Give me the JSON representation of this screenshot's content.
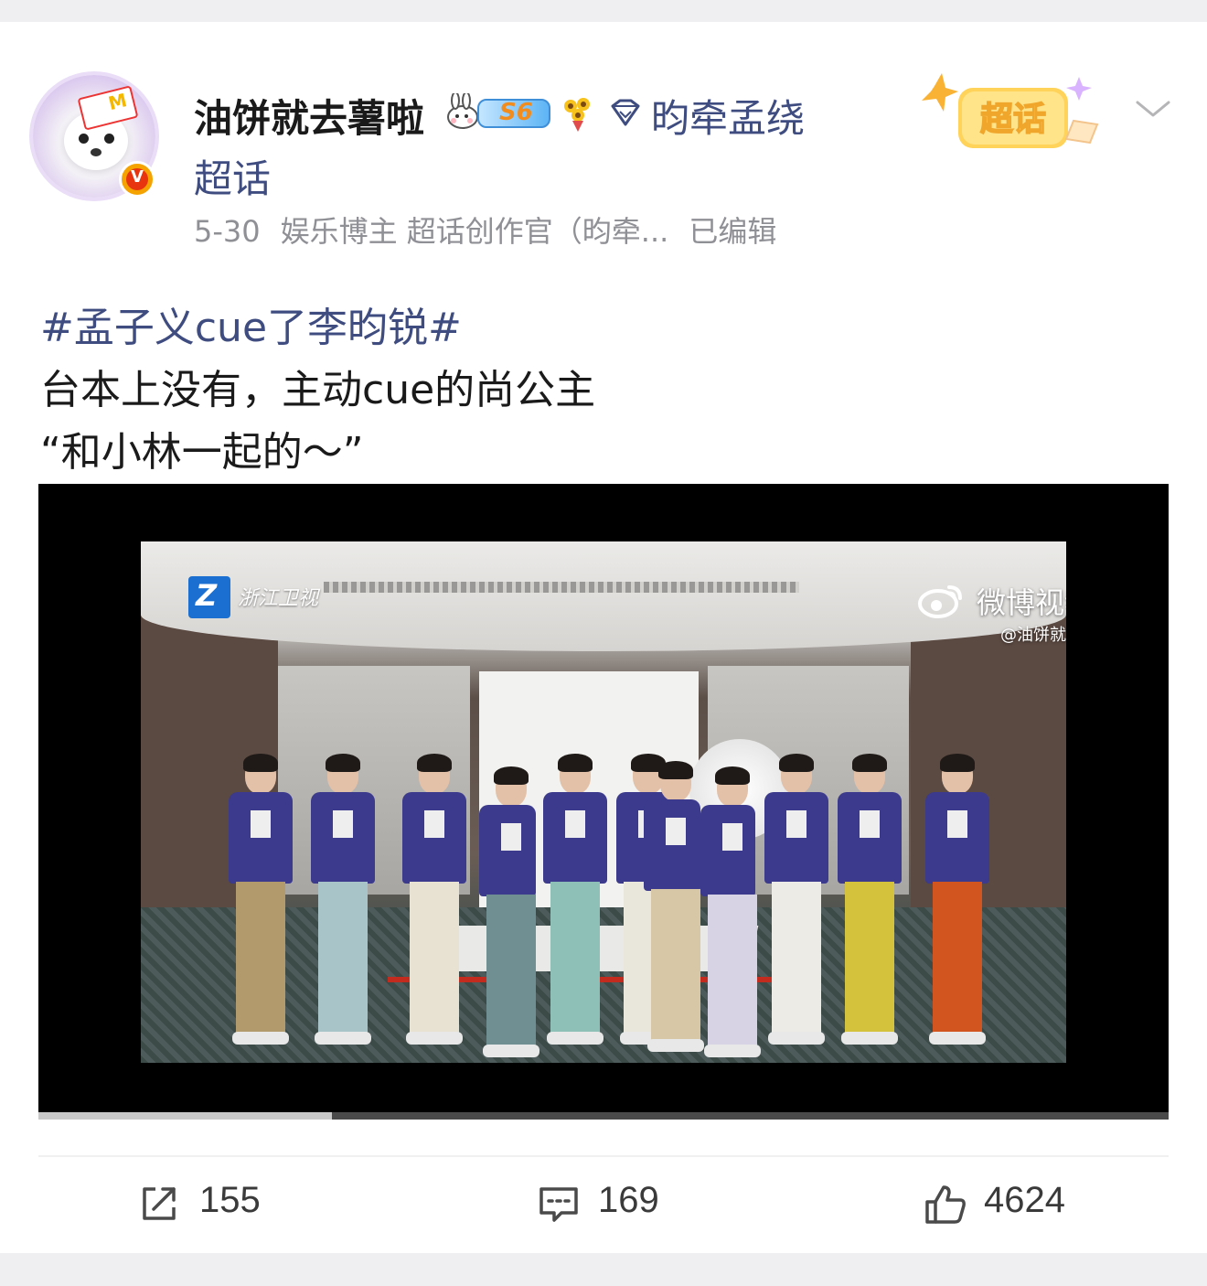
{
  "post": {
    "username": "油饼就去薯啦",
    "level_label": "S6",
    "topic_link_part1": "昀牵孟绕",
    "topic_link_part2": "超话",
    "meta": {
      "date": "5-30",
      "tags": "娱乐博主 超话创作官（昀牵...",
      "edited": "已编辑"
    },
    "supertopic_badge": "超话",
    "hashtag": "#孟子义cue了李昀锐#",
    "text_line1": "台本上没有，主动cue的尚公主",
    "text_line2": "“和小林一起的～”"
  },
  "video": {
    "channel_logo_text": "浙江卫视",
    "watermark_title": "微博视频号",
    "watermark_handle": "@油饼就去薯啦",
    "progress_fraction": 0.26
  },
  "actions": {
    "repost_count": "155",
    "comment_count": "169",
    "like_count": "4624"
  },
  "icons": {
    "repost": "repost-icon",
    "comment": "comment-icon",
    "like": "like-icon",
    "more": "chevron-down-icon"
  },
  "colors": {
    "link": "#3e4c80",
    "text": "#1a1a1a",
    "meta": "#8f8f96",
    "verified": "#f5a300"
  }
}
